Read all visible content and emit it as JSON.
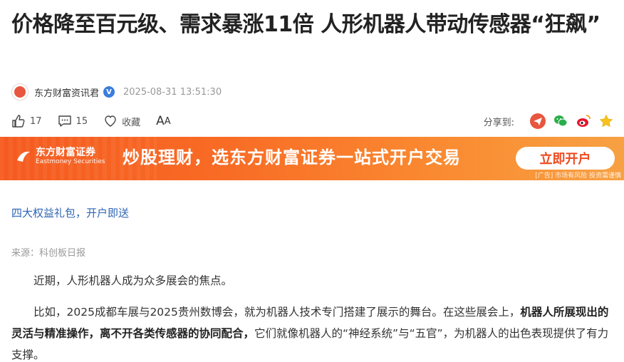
{
  "article": {
    "title": "价格降至百元级、需求暴涨11倍 人形机器人带动传感器“狂飙”",
    "author": "东方财富资讯君",
    "date": "2025-08-31 13:51:30"
  },
  "actions": {
    "like_count": "17",
    "comment_count": "15",
    "favorite_label": "收藏",
    "font_label_big": "A",
    "font_label_small": "A",
    "share_label": "分享到:"
  },
  "share_icons": [
    "share-icon",
    "wechat-icon",
    "weibo-icon",
    "star-icon"
  ],
  "banner": {
    "brand_cn": "东方财富证券",
    "brand_en": "Eastmoney Securities",
    "slogan": "炒股理财，选东方财富证券一站式开户交易",
    "button": "立即开户",
    "ad_note": "[广告] 市场有风险 投资需谨慎",
    "colors": {
      "start": "#f55a1f",
      "end": "#f7a143",
      "button_text": "#ee4a1f"
    }
  },
  "promo_link": "四大权益礼包，开户即送",
  "source": "来源：科创板日报",
  "paragraphs": {
    "p1": "近期，人形机器人成为众多展会的焦点。",
    "p2_a": "比如，2025成都车展与2025贵州数博会，就为机器人技术专门搭建了展示的舞台。在这些展会上，",
    "p2_bold": "机器人所展现出的灵活与精准操作，离不开各类传感器的协同配合，",
    "p2_b": "它们就像机器人的“神经系统”与“五官”，为机器人的出色表现提供了有力支撑。"
  }
}
